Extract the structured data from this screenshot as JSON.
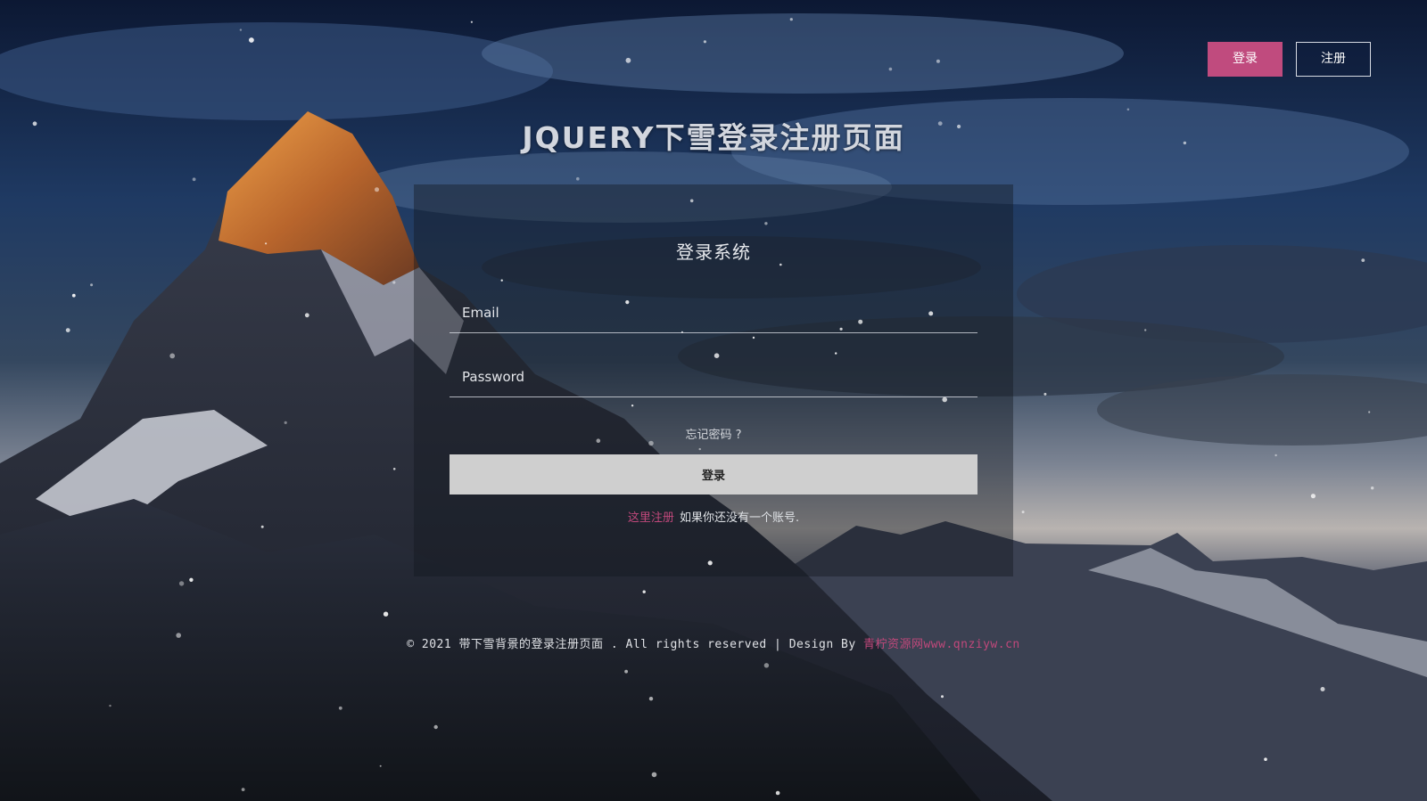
{
  "header": {
    "login_label": "登录",
    "register_label": "注册"
  },
  "page": {
    "title": "JQUERY下雪登录注册页面"
  },
  "login_form": {
    "heading": "登录系统",
    "email_placeholder": "Email",
    "password_placeholder": "Password",
    "forgot_label": "忘记密码 ?",
    "submit_label": "登录",
    "signup_link": "这里注册",
    "signup_text": "如果你还没有一个账号."
  },
  "footer": {
    "copyright": "© 2021 带下雪背景的登录注册页面 . All rights reserved | Design By",
    "credit_link": "青柠资源网www.qnziyw.cn"
  },
  "colors": {
    "accent": "#c04b7e",
    "submit_bg": "#cfcfcf"
  }
}
